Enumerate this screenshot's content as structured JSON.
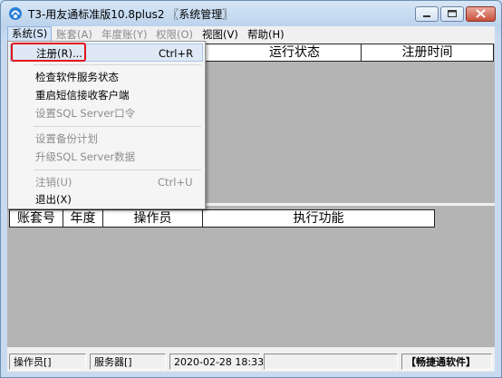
{
  "window": {
    "title": "T3-用友通标准版10.8plus2 〖系统管理〗"
  },
  "menubar": {
    "items": [
      {
        "label": "系统(S)",
        "enabled": true,
        "open": true
      },
      {
        "label": "账套(A)",
        "enabled": false
      },
      {
        "label": "年度账(Y)",
        "enabled": false
      },
      {
        "label": "权限(O)",
        "enabled": false
      },
      {
        "label": "视图(V)",
        "enabled": true
      },
      {
        "label": "帮助(H)",
        "enabled": true
      }
    ]
  },
  "system_menu": {
    "items": [
      {
        "label": "注册(R)...",
        "shortcut": "Ctrl+R",
        "enabled": true,
        "highlighted": true
      },
      {
        "label": "检查软件服务状态",
        "shortcut": "",
        "enabled": true
      },
      {
        "label": "重启短信接收客户端",
        "shortcut": "",
        "enabled": true
      },
      {
        "label": "设置SQL Server口令",
        "shortcut": "",
        "enabled": false
      },
      {
        "label": "设置备份计划",
        "shortcut": "",
        "enabled": false
      },
      {
        "label": "升级SQL Server数据",
        "shortcut": "",
        "enabled": false
      },
      {
        "label": "注销(U)",
        "shortcut": "Ctrl+U",
        "enabled": false
      },
      {
        "label": "退出(X)",
        "shortcut": "",
        "enabled": true
      }
    ]
  },
  "top_grid": {
    "columns": [
      "运行状态",
      "注册时间"
    ]
  },
  "bottom_grid": {
    "columns": [
      "账套号",
      "年度",
      "操作员",
      "执行功能"
    ]
  },
  "statusbar": {
    "operator": "操作员[]",
    "server": "服务器[]",
    "datetime": "2020-02-28 18:33",
    "brand": "【畅捷通软件】"
  },
  "colors": {
    "highlight_border": "#e0141e",
    "workspace": "#b4b4b4"
  }
}
